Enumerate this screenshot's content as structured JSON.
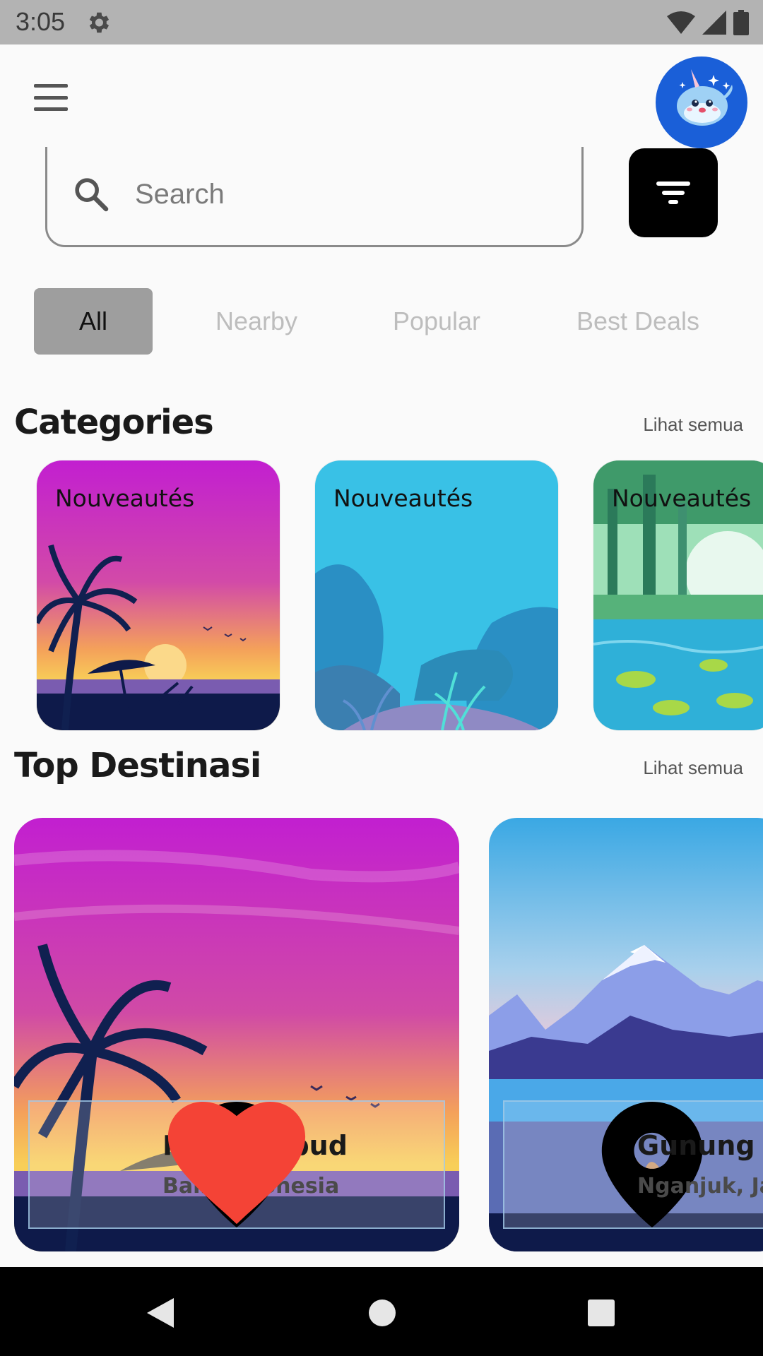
{
  "status_bar": {
    "time": "3:05"
  },
  "header": {
    "menu_icon": "hamburger-menu-icon",
    "avatar_icon": "narwhal-avatar"
  },
  "search": {
    "placeholder": "Search",
    "value": ""
  },
  "filter": {
    "icon": "filter-icon"
  },
  "tabs": [
    {
      "label": "All",
      "active": true
    },
    {
      "label": "Nearby",
      "active": false
    },
    {
      "label": "Popular",
      "active": false
    },
    {
      "label": "Best Deals",
      "active": false
    }
  ],
  "categories": {
    "title": "Categories",
    "see_all": "Lihat semua",
    "items": [
      {
        "label": "Nouveautés",
        "scene": "sunset-beach"
      },
      {
        "label": "Nouveautés",
        "scene": "underwater"
      },
      {
        "label": "Nouveautés",
        "scene": "forest-lake"
      }
    ]
  },
  "top_destinations": {
    "title": "Top Destinasi",
    "see_all": "Lihat semua",
    "items": [
      {
        "name": "Pantai Ubud",
        "location": "Bali, Indonesia",
        "favorite": true,
        "scene": "sunset-beach"
      },
      {
        "name": "Gunung F",
        "location": "Nganjuk, Ja",
        "favorite": false,
        "scene": "mountains"
      }
    ]
  },
  "colors": {
    "accent": "#1a5fd8",
    "active_tab": "#9e9e9e",
    "heart": "#f44336"
  }
}
